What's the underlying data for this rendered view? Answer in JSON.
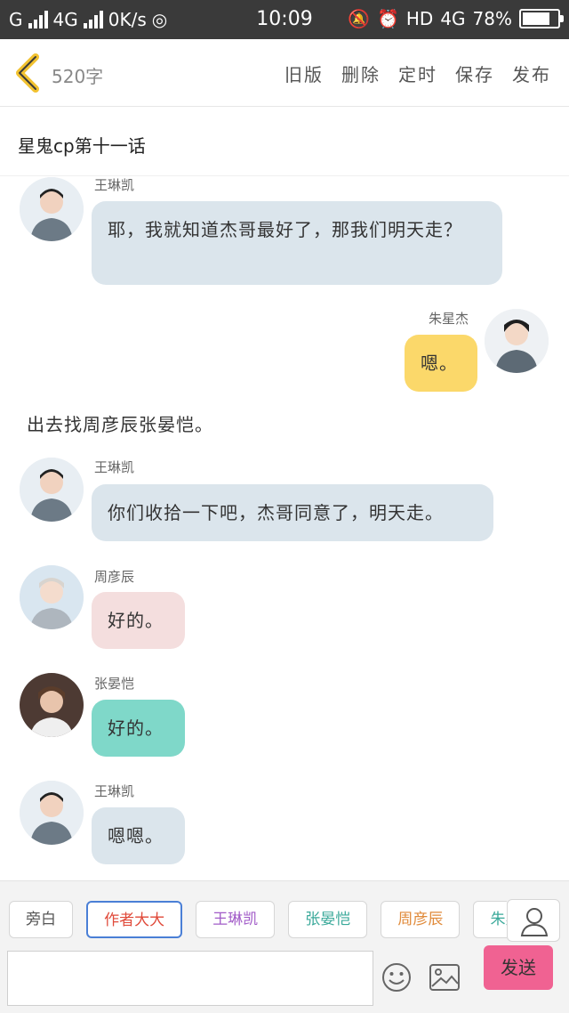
{
  "status_bar": {
    "carrier_left": "G",
    "network_left": "4G",
    "speed": "0K/s",
    "time": "10:09",
    "hd": "HD",
    "network_right": "4G",
    "battery_percent": "78%",
    "battery_level": 0.78
  },
  "header": {
    "word_count": "520字",
    "actions": [
      "旧版",
      "删除",
      "定时",
      "保存",
      "发布"
    ]
  },
  "story": {
    "title": "星鬼cp第十一话"
  },
  "messages": [
    {
      "type": "left",
      "name": "王琳凯",
      "text": "耶，我就知道杰哥最好了，那我们明天走？",
      "color": "blue"
    },
    {
      "type": "right",
      "name": "朱星杰",
      "text": "嗯。",
      "color": "yellow"
    },
    {
      "type": "narration",
      "text": "出去找周彦辰张晏恺。"
    },
    {
      "type": "left",
      "name": "王琳凯",
      "text": "你们收拾一下吧，杰哥同意了，明天走。",
      "color": "blue"
    },
    {
      "type": "left",
      "name": "周彦辰",
      "text": "好的。",
      "color": "pink"
    },
    {
      "type": "left",
      "name": "张晏恺",
      "text": "好的。",
      "color": "teal"
    },
    {
      "type": "left",
      "name": "王琳凯",
      "text": "嗯嗯。",
      "color": "blue"
    }
  ],
  "roles": [
    {
      "label": "旁白",
      "color": "#555555"
    },
    {
      "label": "作者大大",
      "color": "#e04a3a"
    },
    {
      "label": "王琳凯",
      "color": "#a25cc8"
    },
    {
      "label": "张晏恺",
      "color": "#3aa99a"
    },
    {
      "label": "周彦辰",
      "color": "#e08a3a"
    },
    {
      "label": "朱星杰",
      "color": "#3aa99a"
    }
  ],
  "composer": {
    "send_label": "发送"
  },
  "colors": {
    "accent": "#f06292",
    "back_arrow": "#f2c230"
  }
}
